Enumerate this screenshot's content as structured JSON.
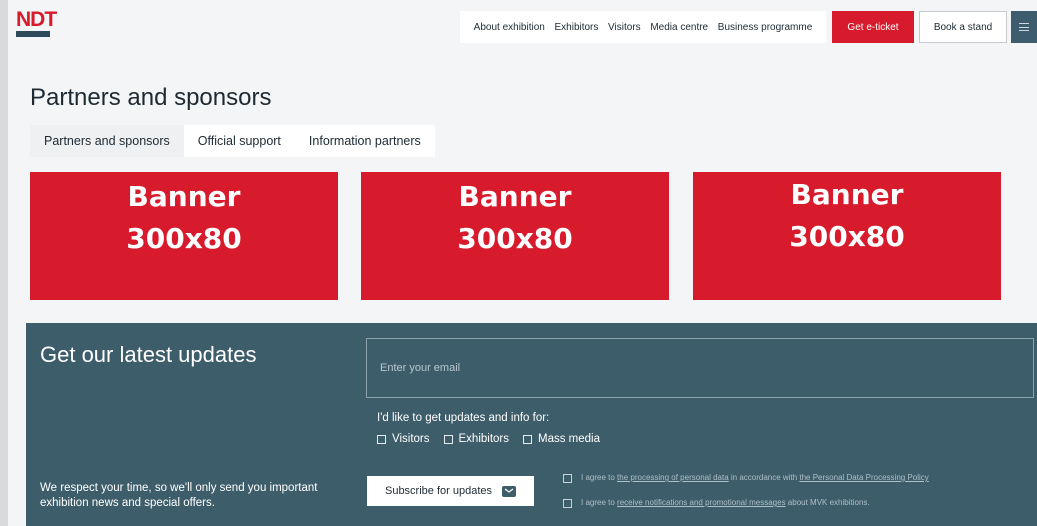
{
  "header": {
    "logo_text": "NDT",
    "nav": [
      {
        "label": "About exhibition"
      },
      {
        "label": "Exhibitors"
      },
      {
        "label": "Visitors"
      },
      {
        "label": "Media centre"
      },
      {
        "label": "Business programme"
      }
    ],
    "ticket_label": "Get e-ticket",
    "stand_label": "Book a stand",
    "menu_icon": "hamburger-icon"
  },
  "main": {
    "title": "Partners and sponsors",
    "tabs": [
      {
        "label": "Partners and sponsors",
        "active": true
      },
      {
        "label": "Official support",
        "active": false
      },
      {
        "label": "Information partners",
        "active": false
      }
    ],
    "banners": [
      {
        "line1": "Banner",
        "line2": "300x80"
      },
      {
        "line1": "Banner",
        "line2": "300x80"
      },
      {
        "line1": "Banner",
        "line2": "300x80"
      }
    ]
  },
  "newsletter": {
    "title": "Get our latest updates",
    "email_placeholder": "Enter your email",
    "interest_label": "I'd like to get updates and info for:",
    "interests": [
      {
        "label": "Visitors"
      },
      {
        "label": "Exhibitors"
      },
      {
        "label": "Mass media"
      }
    ],
    "respect_text": "We respect your time, so we'll only send you important exhibition news and special offers.",
    "subscribe_label": "Subscribe for updates",
    "consent1": {
      "pre": "I agree to ",
      "link1": "the processing of personal data",
      "mid": " in accordance with ",
      "link2": "the Personal Data Processing Policy"
    },
    "consent2": {
      "pre": "I agree to ",
      "link1": "receive notifications and promotional messages",
      "post": " about MVK exhibitions."
    }
  },
  "colors": {
    "brand_red": "#d71a2c",
    "footer_teal": "#3d5d6b",
    "page_bg": "#f4f5f7"
  }
}
